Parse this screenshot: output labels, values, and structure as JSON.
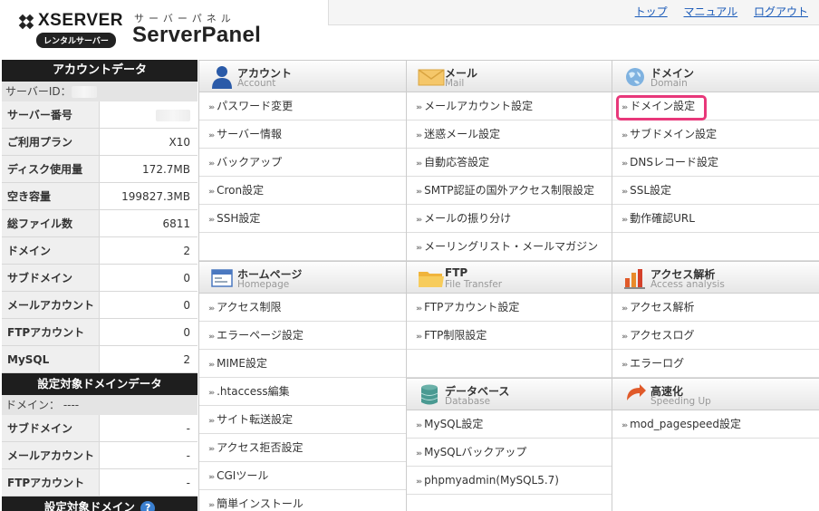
{
  "header": {
    "brand": "XSERVER",
    "brand_sub": "レンタルサーバー",
    "panel_kana": "サーバーパネル",
    "panel_title": "ServerPanel",
    "nav": [
      "トップ",
      "マニュアル",
      "ログアウト"
    ]
  },
  "sidebar": {
    "account_title": "アカウントデータ",
    "server_id_label": "サーバーID：",
    "account_rows": [
      {
        "label": "サーバー番号",
        "value": ""
      },
      {
        "label": "ご利用プラン",
        "value": "X10"
      },
      {
        "label": "ディスク使用量",
        "value": "172.7MB"
      },
      {
        "label": "空き容量",
        "value": "199827.3MB"
      },
      {
        "label": "総ファイル数",
        "value": "6811"
      },
      {
        "label": "ドメイン",
        "value": "2"
      },
      {
        "label": "サブドメイン",
        "value": "0"
      },
      {
        "label": "メールアカウント",
        "value": "0"
      },
      {
        "label": "FTPアカウント",
        "value": "0"
      },
      {
        "label": "MySQL",
        "value": "2"
      }
    ],
    "domain_title": "設定対象ドメインデータ",
    "domain_label": "ドメイン： ----",
    "domain_rows": [
      {
        "label": "サブドメイン",
        "value": "-"
      },
      {
        "label": "メールアカウント",
        "value": "-"
      },
      {
        "label": "FTPアカウント",
        "value": "-"
      }
    ],
    "bottom_title": "設定対象ドメイン",
    "help": "?"
  },
  "sections": {
    "account": {
      "jp": "アカウント",
      "en": "Account",
      "items": [
        "パスワード変更",
        "サーバー情報",
        "バックアップ",
        "Cron設定",
        "SSH設定"
      ]
    },
    "mail": {
      "jp": "メール",
      "en": "Mail",
      "items": [
        "メールアカウント設定",
        "迷惑メール設定",
        "自動応答設定",
        "SMTP認証の国外アクセス制限設定",
        "メールの振り分け",
        "メーリングリスト・メールマガジン"
      ]
    },
    "domain": {
      "jp": "ドメイン",
      "en": "Domain",
      "items": [
        "ドメイン設定",
        "サブドメイン設定",
        "DNSレコード設定",
        "SSL設定",
        "動作確認URL"
      ]
    },
    "homepage": {
      "jp": "ホームページ",
      "en": "Homepage",
      "items": [
        "アクセス制限",
        "エラーページ設定",
        "MIME設定",
        ".htaccess編集",
        "サイト転送設定",
        "アクセス拒否設定",
        "CGIツール",
        "簡単インストール"
      ]
    },
    "ftp": {
      "jp": "FTP",
      "en": "File Transfer",
      "items": [
        "FTPアカウント設定",
        "FTP制限設定"
      ]
    },
    "access": {
      "jp": "アクセス解析",
      "en": "Access analysis",
      "items": [
        "アクセス解析",
        "アクセスログ",
        "エラーログ"
      ]
    },
    "database": {
      "jp": "データベース",
      "en": "Database",
      "items": [
        "MySQL設定",
        "MySQLバックアップ",
        "phpmyadmin(MySQL5.7)"
      ]
    },
    "speed": {
      "jp": "高速化",
      "en": "Speeding Up",
      "items": [
        "mod_pagespeed設定"
      ]
    }
  },
  "colors": {
    "highlight": "#e8387a",
    "sidebar_header": "#1e1e1e",
    "link": "#1a5ab8"
  }
}
